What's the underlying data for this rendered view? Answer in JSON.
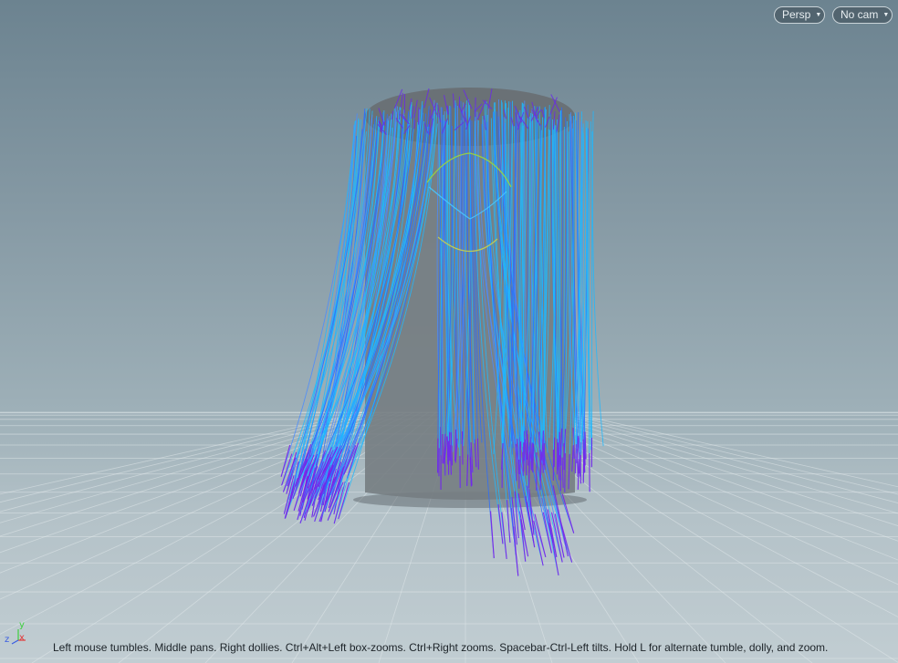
{
  "viewport": {
    "view_menu_label": "Persp",
    "camera_menu_label": "No cam",
    "status_hint": "Left mouse tumbles. Middle pans. Right dollies. Ctrl+Alt+Left box-zooms. Ctrl+Right zooms. Spacebar-Ctrl-Left tilts. Hold L for alternate tumble, dolly, and zoom.",
    "axis_labels": {
      "x": "x",
      "y": "y",
      "z": "z"
    },
    "colors": {
      "hair_light": "#1fb8ff",
      "hair_mid": "#2a6dff",
      "hair_tip": "#7a1fe8",
      "guide_green": "#9bd93a",
      "cylinder": "#6d7479",
      "grid": "#e6ecee"
    },
    "icons": {
      "view_caret": "caret-down-icon",
      "camera_caret": "caret-down-icon"
    }
  }
}
